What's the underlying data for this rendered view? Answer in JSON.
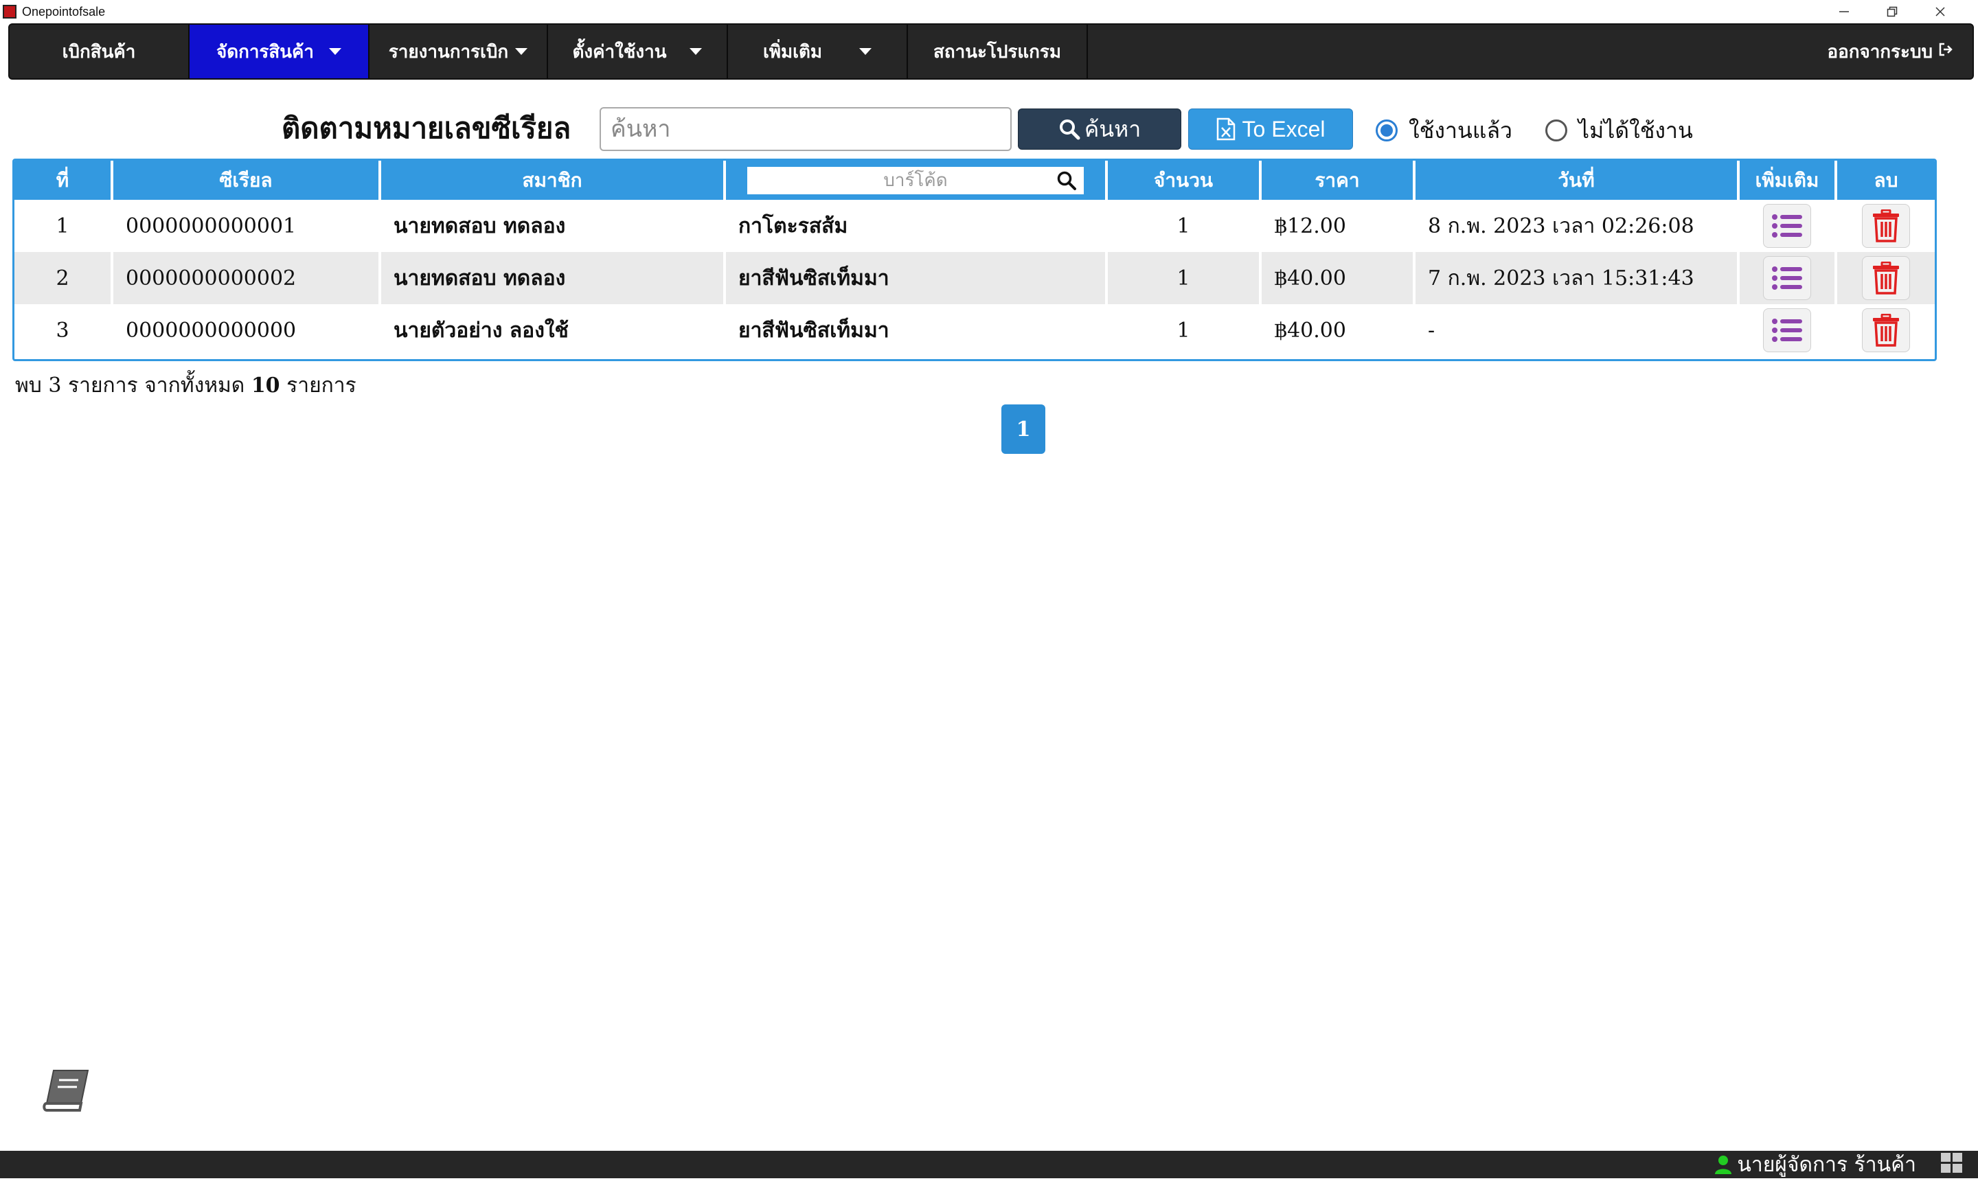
{
  "window": {
    "title": "Onepointofsale"
  },
  "nav": {
    "items": [
      {
        "label": "เบิกสินค้า"
      },
      {
        "label": "จัดการสินค้า"
      },
      {
        "label": "รายงานการเบิก"
      },
      {
        "label": "ตั้งค่าใช้งาน"
      },
      {
        "label": "เพิ่มเติม"
      },
      {
        "label": "สถานะโปรแกรม"
      }
    ],
    "logout_label": "ออกจากระบบ"
  },
  "search": {
    "title": "ติดตามหมายเลขซีเรียล",
    "placeholder": "ค้นหา",
    "search_button": "ค้นหา",
    "excel_button": "To Excel",
    "radio_used": "ใช้งานแล้ว",
    "radio_unused": "ไม่ได้ใช้งาน"
  },
  "table": {
    "headers": {
      "no": "ที่",
      "serial": "ซีเรียล",
      "member": "สมาชิก",
      "barcode_placeholder": "บาร์โค้ด",
      "qty": "จำนวน",
      "price": "ราคา",
      "date": "วันที่",
      "more": "เพิ่มเติม",
      "delete": "ลบ"
    },
    "rows": [
      {
        "no": "1",
        "serial": "0000000000001",
        "member": "นายทดสอบ ทดลอง",
        "product": "กาโตะรสส้ม",
        "qty": "1",
        "price": "฿12.00",
        "date": "8 ก.พ. 2023 เวลา 02:26:08"
      },
      {
        "no": "2",
        "serial": "0000000000002",
        "member": "นายทดสอบ ทดลอง",
        "product": "ยาสีฟันซิสเท็มมา",
        "qty": "1",
        "price": "฿40.00",
        "date": "7 ก.พ. 2023 เวลา 15:31:43"
      },
      {
        "no": "3",
        "serial": "0000000000000",
        "member": "นายตัวอย่าง ลองใช้",
        "product": "ยาสีฟันซิสเท็มมา",
        "qty": "1",
        "price": "฿40.00",
        "date": "-"
      }
    ]
  },
  "summary": {
    "prefix": "พบ",
    "found": "3",
    "middle": "รายการ จากทั้งหมด",
    "total": "10",
    "suffix": "รายการ"
  },
  "pagination": {
    "current": "1"
  },
  "statusbar": {
    "user": "นายผู้จัดการ ร้านค้า"
  },
  "colors": {
    "accent": "#3399e0",
    "nav_bg": "#262626",
    "nav_active": "#1010d0",
    "list_icon": "#8e44ad",
    "delete_icon": "#e02020",
    "user_icon": "#22cc22"
  }
}
